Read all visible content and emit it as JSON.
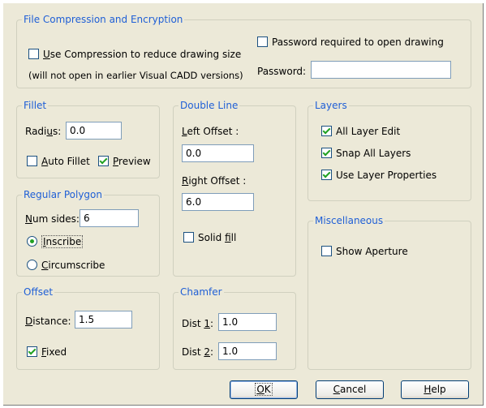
{
  "compression": {
    "title": "File Compression and Encryption",
    "use_compression": {
      "label_pre": "",
      "mnemonic": "U",
      "label_post": "se Compression to reduce drawing size",
      "checked": false
    },
    "note": "(will not open in earlier Visual CADD versions)",
    "password_required": {
      "label": "Password required to open drawing",
      "checked": false
    },
    "password_label": "Password:",
    "password_value": ""
  },
  "fillet": {
    "title": "Fillet",
    "radius_label_pre": "Radi",
    "radius_mnemonic": "u",
    "radius_label_post": "s:",
    "radius_value": "0.0",
    "auto_fillet": {
      "mnemonic": "A",
      "label_post": "uto Fillet",
      "checked": false
    },
    "preview": {
      "mnemonic": "P",
      "label_post": "review",
      "checked": true
    }
  },
  "double_line": {
    "title": "Double Line",
    "left_mnemonic": "L",
    "left_label_post": "eft Offset :",
    "left_value": "0.0",
    "right_mnemonic": "R",
    "right_label_post": "ight Offset :",
    "right_value": "6.0",
    "solid_fill": {
      "label_pre": "Solid ",
      "mnemonic": "f",
      "label_post": "ill",
      "checked": false
    }
  },
  "layers": {
    "title": "Layers",
    "all_layer_edit": {
      "label": "All Layer Edit",
      "checked": true
    },
    "snap_all_layers": {
      "label": "Snap All Layers",
      "checked": true
    },
    "use_layer_properties": {
      "label": "Use Layer Properties",
      "checked": true
    }
  },
  "polygon": {
    "title": "Regular Polygon",
    "num_sides_mnemonic": "N",
    "num_sides_label_post": "um sides:",
    "num_sides_value": "6",
    "inscribe": {
      "mnemonic": "I",
      "label_post": "nscribe",
      "selected": true
    },
    "circumscribe": {
      "mnemonic": "C",
      "label_post": "ircumscribe",
      "selected": false
    }
  },
  "misc": {
    "title": "Miscellaneous",
    "show_aperture": {
      "label": "Show Aperture",
      "checked": false
    }
  },
  "offset": {
    "title": "Offset",
    "distance_mnemonic": "D",
    "distance_label_post": "istance:",
    "distance_value": "1.5",
    "fixed": {
      "mnemonic": "F",
      "label_post": "ixed",
      "checked": true
    }
  },
  "chamfer": {
    "title": "Chamfer",
    "dist1_label_pre": "Dist ",
    "dist1_mnemonic": "1",
    "dist1_label_post": ":",
    "dist1_value": "1.0",
    "dist2_label_pre": "Dist ",
    "dist2_mnemonic": "2",
    "dist2_label_post": ":",
    "dist2_value": "1.0"
  },
  "buttons": {
    "ok": {
      "mnemonic": "O",
      "label_post": "K"
    },
    "cancel": {
      "mnemonic": "C",
      "label_post": "ancel"
    },
    "help": {
      "mnemonic": "H",
      "label_post": "elp"
    }
  }
}
